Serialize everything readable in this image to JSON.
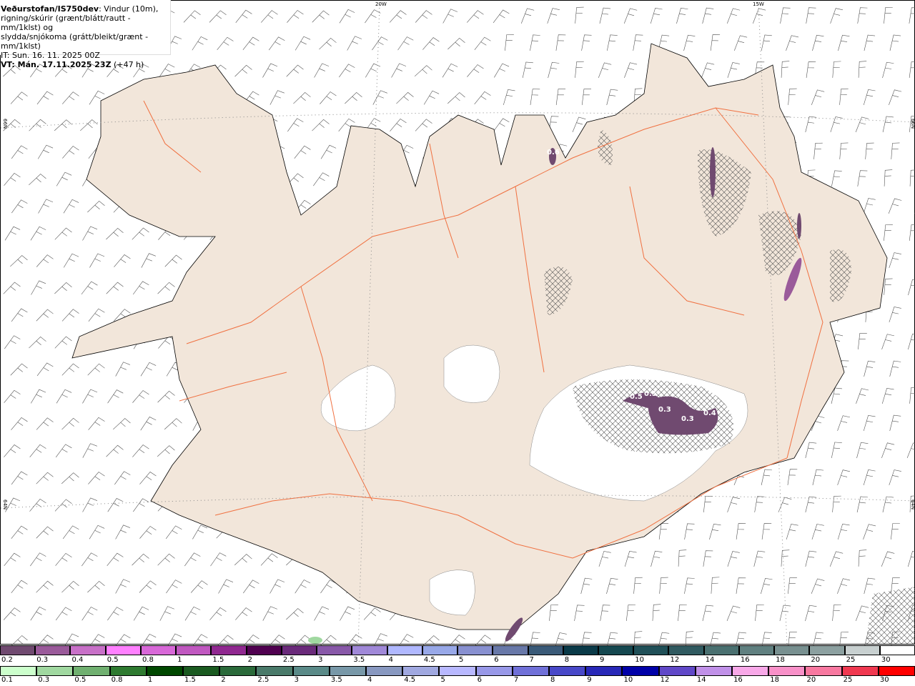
{
  "header": {
    "source": "Veðurstofan/IS750dev",
    "description_1": ": Vindur (10m),",
    "description_2": "rigning/skúrir (grænt/blátt/rautt - mm/1klst) og",
    "description_3": "slydda/snjókoma (grátt/bleikt/grænt - mm/1klst)",
    "initial_time": "IT: Sun. 16. 11. 2025 00Z",
    "valid_time_bold": "VT: Mán. 17.11.2025 23Z",
    "valid_time_offset": " (+47 h)"
  },
  "graticule": {
    "lon_labels": [
      "20W",
      "15W"
    ],
    "lat_labels": [
      "66N",
      "64N"
    ]
  },
  "map_labels": [
    "0.6",
    "0.5",
    "0.5",
    "0.3",
    "0.3",
    "0.4"
  ],
  "colors": {
    "land": "#f2e6da",
    "roads": "#f07040",
    "glacier": "#ffffff",
    "coast": "#000000"
  },
  "legend_snow": {
    "labels": [
      "0.2",
      "0.3",
      "0.4",
      "0.5",
      "0.8",
      "1",
      "1.5",
      "2",
      "2.5",
      "3",
      "3.5",
      "4",
      "4.5",
      "5",
      "6",
      "7",
      "8",
      "9",
      "10",
      "12",
      "14",
      "16",
      "18",
      "20",
      "25",
      "30"
    ],
    "colors": [
      "#704a70",
      "#9a5a9a",
      "#c870c8",
      "#ff80ff",
      "#d868d8",
      "#c058c0",
      "#902890",
      "#500050",
      "#6a2a7a",
      "#8858a8",
      "#a088d8",
      "#b0b8ff",
      "#98a8e8",
      "#8890d0",
      "#6878a8",
      "#3a5a78",
      "#0a3a48",
      "#154850",
      "#205058",
      "#305a60",
      "#4a7070",
      "#608080",
      "#789090",
      "#8ca0a0",
      "#c8d0d0",
      "#ffffff"
    ]
  },
  "legend_rain": {
    "labels": [
      "0.1",
      "0.3",
      "0.5",
      "0.8",
      "1",
      "1.5",
      "2",
      "2.5",
      "3",
      "3.5",
      "4",
      "4.5",
      "5",
      "6",
      "7",
      "8",
      "9",
      "10",
      "12",
      "14",
      "16",
      "18",
      "20",
      "25",
      "30"
    ],
    "colors": [
      "#ccffcc",
      "#a0d8a0",
      "#70b070",
      "#2e7a30",
      "#004800",
      "#1a5a20",
      "#2a6a3a",
      "#4a7a6a",
      "#5a8a88",
      "#7898a8",
      "#8898c0",
      "#a0a8e0",
      "#b8b8ff",
      "#9898e8",
      "#7070d8",
      "#4848c8",
      "#2828b8",
      "#0000a8",
      "#6048c8",
      "#c090e8",
      "#f8a8e8",
      "#f890c8",
      "#f878a0",
      "#f03850",
      "#ff0000"
    ]
  }
}
